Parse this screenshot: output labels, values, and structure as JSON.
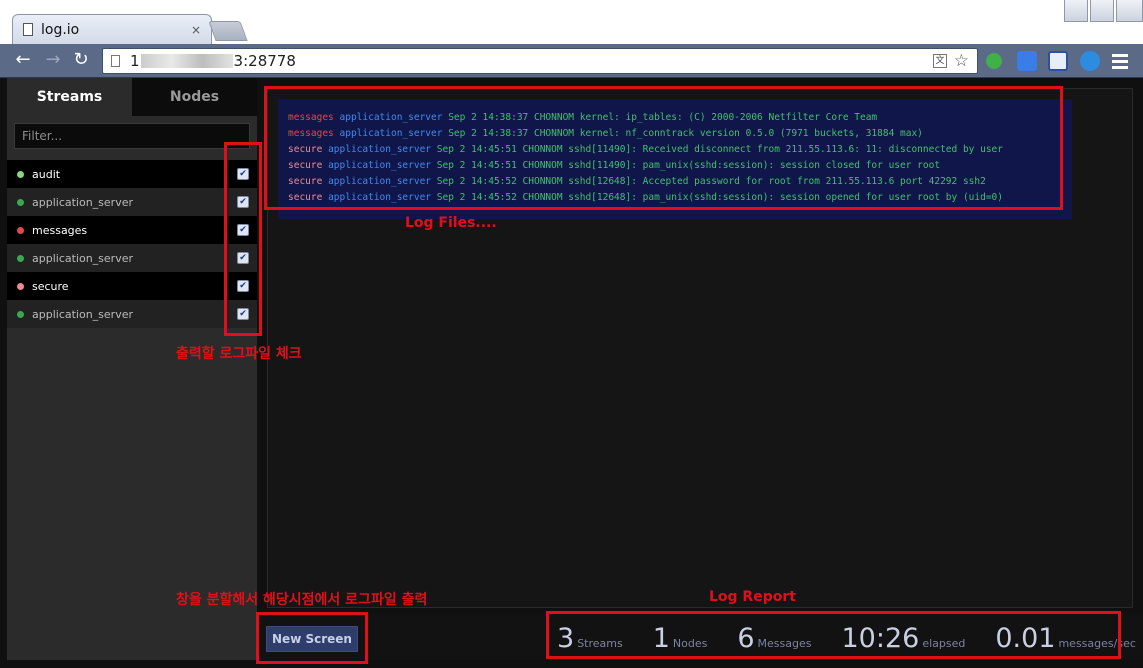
{
  "browser": {
    "tab_title": "log.io",
    "tab_close": "×",
    "url_prefix": "1",
    "url_suffix": "3:28778"
  },
  "sidebar": {
    "tabs": [
      {
        "label": "Streams",
        "active": true
      },
      {
        "label": "Nodes",
        "active": false
      }
    ],
    "filter_placeholder": "Filter...",
    "streams": [
      {
        "label": "audit",
        "kind": "main",
        "dot": "#8cd47e",
        "checked": true
      },
      {
        "label": "application_server",
        "kind": "sub",
        "dot": "#3aa84f",
        "checked": true
      },
      {
        "label": "messages",
        "kind": "main",
        "dot": "#e04a4a",
        "checked": true
      },
      {
        "label": "application_server",
        "kind": "sub",
        "dot": "#3aa84f",
        "checked": true
      },
      {
        "label": "secure",
        "kind": "main",
        "dot": "#ef8b8b",
        "checked": true
      },
      {
        "label": "application_server",
        "kind": "sub",
        "dot": "#3aa84f",
        "checked": true
      }
    ]
  },
  "logs": [
    {
      "stream": "messages",
      "node": "application_server",
      "text": "Sep 2 14:38:37 CHONNOM kernel: ip_tables: (C) 2000-2006 Netfilter Core Team"
    },
    {
      "stream": "messages",
      "node": "application_server",
      "text": "Sep 2 14:38:37 CHONNOM kernel: nf_conntrack version 0.5.0 (7971 buckets, 31884 max)"
    },
    {
      "stream": "secure",
      "node": "application_server",
      "text": "Sep 2 14:45:51 CHONNOM sshd[11490]: Received disconnect from 211.55.113.6: 11: disconnected by user"
    },
    {
      "stream": "secure",
      "node": "application_server",
      "text": "Sep 2 14:45:51 CHONNOM sshd[11490]: pam_unix(sshd:session): session closed for user root"
    },
    {
      "stream": "secure",
      "node": "application_server",
      "text": "Sep 2 14:45:52 CHONNOM sshd[12648]: Accepted password for root from 211.55.113.6 port 42292 ssh2"
    },
    {
      "stream": "secure",
      "node": "application_server",
      "text": "Sep 2 14:45:52 CHONNOM sshd[12648]: pam_unix(sshd:session): session opened for user root by (uid=0)"
    }
  ],
  "bottom": {
    "new_screen_label": "New Screen",
    "stats": [
      {
        "num": "3",
        "label": "Streams"
      },
      {
        "num": "1",
        "label": "Nodes"
      },
      {
        "num": "6",
        "label": "Messages"
      },
      {
        "num": "10:26",
        "label": "elapsed"
      },
      {
        "num": "0.01",
        "label": "messages/sec"
      }
    ]
  },
  "annotations": {
    "log_files": "Log Files....",
    "check_label": "출력할 로그파일 체크",
    "split_label": "창을 분할해서 해당시점에서 로그파일 출력",
    "report_label": "Log Report"
  }
}
